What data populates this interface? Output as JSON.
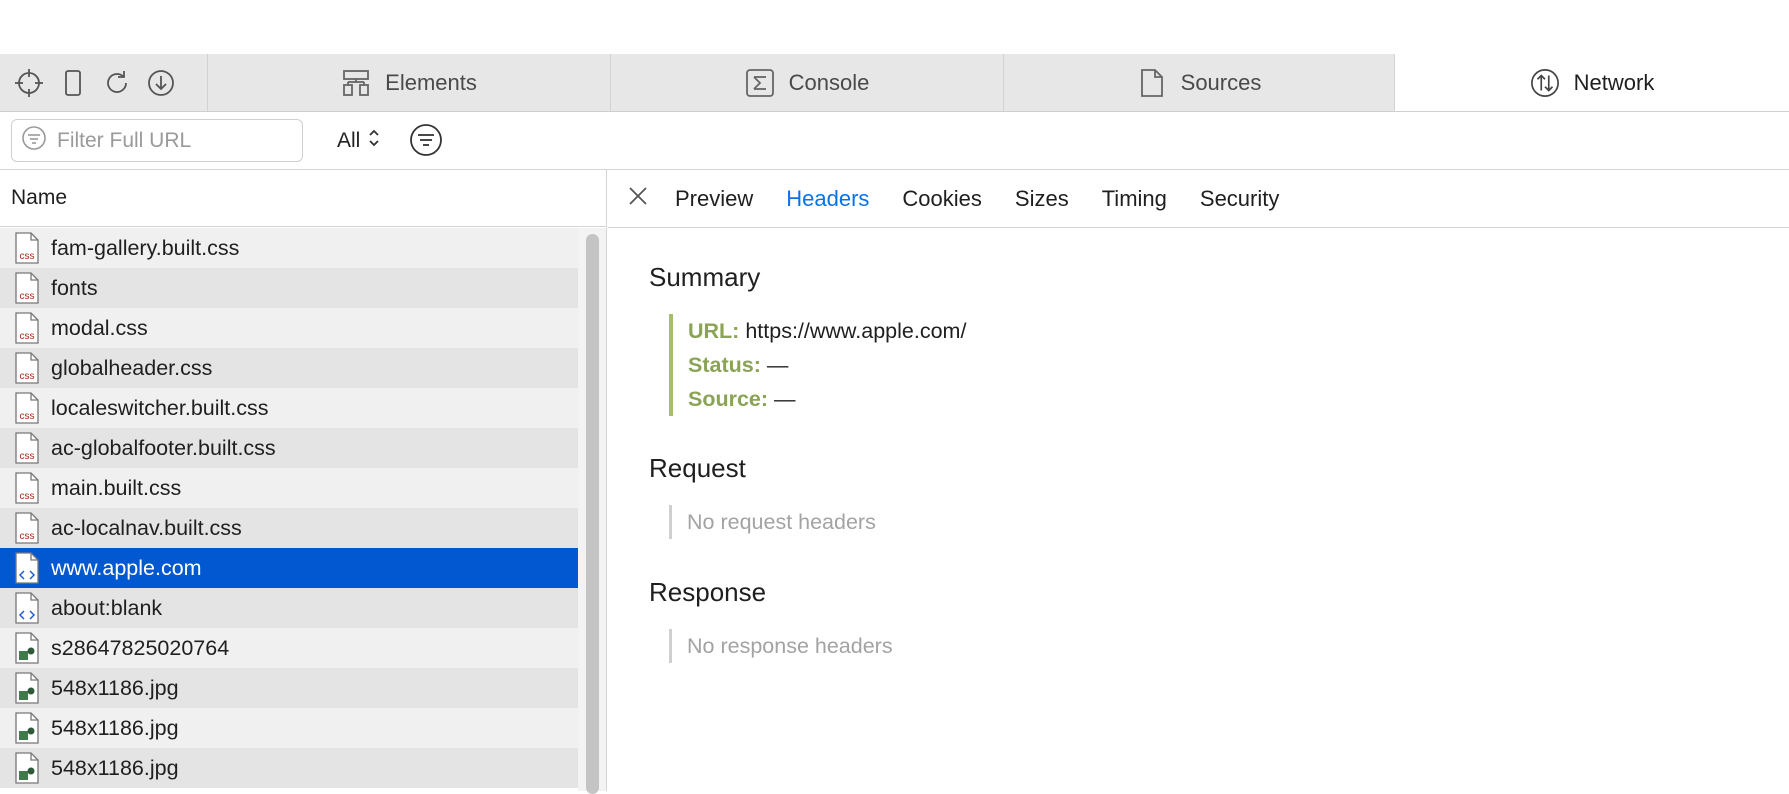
{
  "tabs": [
    {
      "label": "Elements",
      "icon": "elements-icon"
    },
    {
      "label": "Console",
      "icon": "console-icon"
    },
    {
      "label": "Sources",
      "icon": "sources-icon"
    },
    {
      "label": "Network",
      "icon": "network-icon",
      "active": true
    }
  ],
  "toolbar": {
    "tools": [
      "crosshair-icon",
      "device-icon",
      "reload-icon",
      "download-icon"
    ]
  },
  "filter": {
    "placeholder": "Filter Full URL",
    "type_value": "All"
  },
  "list": {
    "header": "Name",
    "items": [
      {
        "name": "fam-gallery.built.css",
        "kind": "css"
      },
      {
        "name": "fonts",
        "kind": "css"
      },
      {
        "name": "modal.css",
        "kind": "css"
      },
      {
        "name": "globalheader.css",
        "kind": "css"
      },
      {
        "name": "localeswitcher.built.css",
        "kind": "css"
      },
      {
        "name": "ac-globalfooter.built.css",
        "kind": "css"
      },
      {
        "name": "main.built.css",
        "kind": "css"
      },
      {
        "name": "ac-localnav.built.css",
        "kind": "css"
      },
      {
        "name": "www.apple.com",
        "kind": "html",
        "selected": true
      },
      {
        "name": "about:blank",
        "kind": "html"
      },
      {
        "name": "s28647825020764",
        "kind": "image"
      },
      {
        "name": "548x1186.jpg",
        "kind": "image"
      },
      {
        "name": "548x1186.jpg",
        "kind": "image"
      },
      {
        "name": "548x1186.jpg",
        "kind": "image"
      }
    ]
  },
  "detail": {
    "tabs": [
      "Preview",
      "Headers",
      "Cookies",
      "Sizes",
      "Timing",
      "Security"
    ],
    "active_tab": "Headers",
    "summary": {
      "title": "Summary",
      "url_label": "URL:",
      "url_value": "https://www.apple.com/",
      "status_label": "Status:",
      "status_value": "—",
      "source_label": "Source:",
      "source_value": "—"
    },
    "request": {
      "title": "Request",
      "empty": "No request headers"
    },
    "response": {
      "title": "Response",
      "empty": "No response headers"
    }
  },
  "colors": {
    "selected_row": "#0158d1",
    "active_tab_text": "#0a72e8",
    "summary_key": "#8ba354",
    "css_icon": "#b3261e",
    "html_icon": "#1f5fd1",
    "image_icon": "#3f7a4b"
  }
}
